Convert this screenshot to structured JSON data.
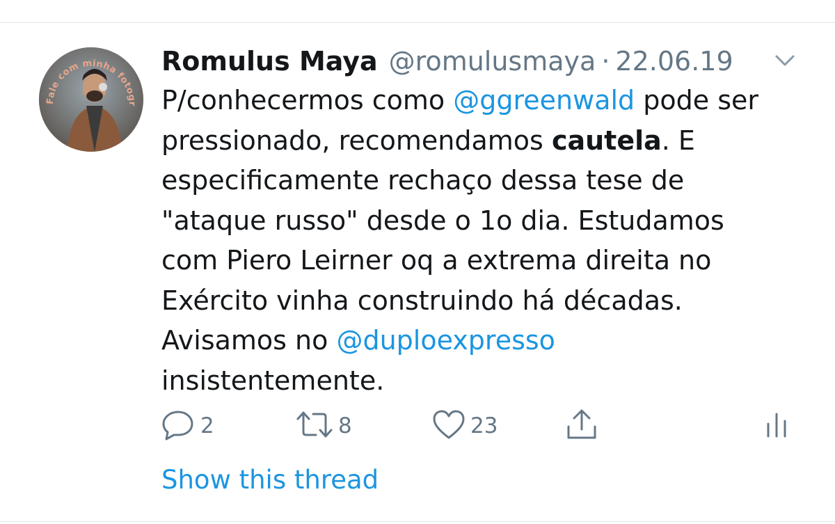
{
  "tweet": {
    "author_name": "Romulus Maya",
    "handle": "@romulusmaya",
    "separator": "·",
    "date": "22.06.19",
    "avatar_ring_text": "Fale com minha fotografia!",
    "body": {
      "l1_pre": "P/conhecermos como ",
      "l1_mention": "@ggreenwald",
      "l1_post": " pode ser",
      "l2_pre": "pressionado, recomendamos ",
      "l2_bold": "cautela",
      "l2_post": ". E",
      "l3": "especificamente rechaço dessa tese de",
      "l4": "\"ataque russo\" desde o 1o dia. Estudamos",
      "l5": "com Piero Leirner oq a extrema direita no",
      "l6": "Exército vinha construindo há décadas.",
      "l7_pre": "Avisamos no ",
      "l7_mention": "@duploexpresso",
      "l8": "insistentemente."
    },
    "actions": {
      "reply_count": "2",
      "retweet_count": "8",
      "like_count": "23"
    },
    "show_thread_label": "Show this thread"
  },
  "icons": {
    "caret": "chevron-down-icon",
    "reply": "reply-icon",
    "retweet": "retweet-icon",
    "like": "heart-icon",
    "share": "share-icon",
    "analytics": "analytics-icon"
  },
  "colors": {
    "link": "#1b95e0",
    "text": "#14171a",
    "secondary": "#657786",
    "avatar_ring_text": "#e8a58c"
  }
}
